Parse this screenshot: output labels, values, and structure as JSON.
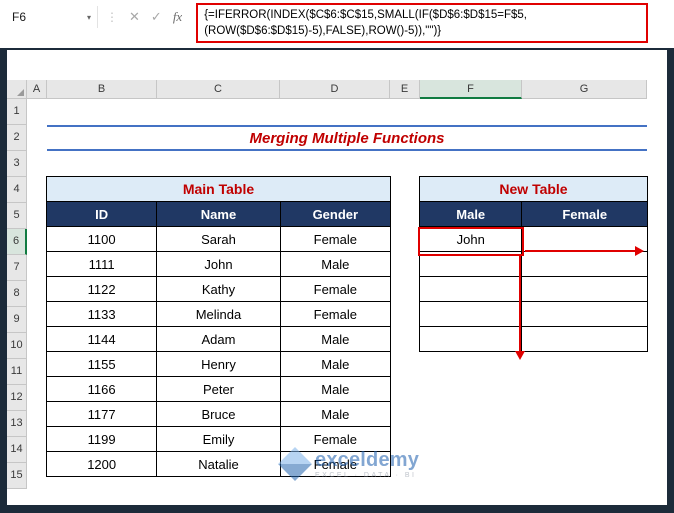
{
  "formula_bar": {
    "cell_reference": "F6",
    "formula_line1": "{=IFERROR(INDEX($C$6:$C$15,SMALL(IF($D$6:$D$15=F$5,",
    "formula_line2": "(ROW($D$6:$D$15)-5),FALSE),ROW()-5)),\"\")}",
    "icons": {
      "dropdown": "▾",
      "menu_dots": "⋮",
      "cancel": "✕",
      "enter": "✓",
      "insert_function": "fx"
    }
  },
  "sheet": {
    "column_headers": [
      "A",
      "B",
      "C",
      "D",
      "E",
      "F",
      "G"
    ],
    "row_headers": [
      "1",
      "2",
      "3",
      "4",
      "5",
      "6",
      "7",
      "8",
      "9",
      "10",
      "11",
      "12",
      "13",
      "14",
      "15"
    ],
    "selected_column": "F",
    "selected_row": "6",
    "title": "Merging Multiple Functions"
  },
  "main_table": {
    "title": "Main Table",
    "headers": [
      "ID",
      "Name",
      "Gender"
    ],
    "rows": [
      [
        "1100",
        "Sarah",
        "Female"
      ],
      [
        "1111",
        "John",
        "Male"
      ],
      [
        "1122",
        "Kathy",
        "Female"
      ],
      [
        "1133",
        "Melinda",
        "Female"
      ],
      [
        "1144",
        "Adam",
        "Male"
      ],
      [
        "1155",
        "Henry",
        "Male"
      ],
      [
        "1166",
        "Peter",
        "Male"
      ],
      [
        "1177",
        "Bruce",
        "Male"
      ],
      [
        "1199",
        "Emily",
        "Female"
      ],
      [
        "1200",
        "Natalie",
        "Female"
      ]
    ]
  },
  "new_table": {
    "title": "New Table",
    "headers": [
      "Male",
      "Female"
    ],
    "rows": [
      [
        "John",
        ""
      ],
      [
        "",
        ""
      ],
      [
        "",
        ""
      ],
      [
        "",
        ""
      ],
      [
        "",
        ""
      ]
    ]
  },
  "watermark": {
    "name": "exceldemy",
    "tagline": "EXCEL · DATA · BI"
  },
  "colors": {
    "accent_red": "#c00000",
    "annotation_red": "#e00000",
    "navy_header": "#203864",
    "light_blue_header": "#ddebf7",
    "title_rule_blue": "#4472c4",
    "selection_green": "#107c41",
    "watermark_blue": "#1d5fae",
    "frame_dark": "#1c2b3a"
  }
}
